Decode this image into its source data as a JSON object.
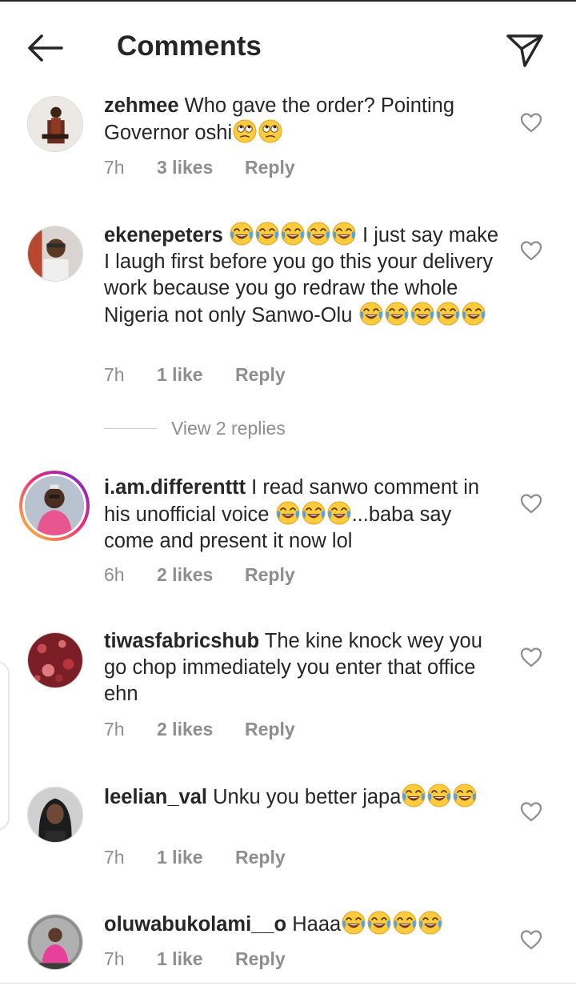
{
  "header": {
    "title": "Comments",
    "back_icon": "arrow-left-icon",
    "share_icon": "paper-plane-icon"
  },
  "view_replies_label": "View 2 replies",
  "comments": [
    {
      "username": "zehmee",
      "text_before": " Who gave the order? Pointing Governor oshi",
      "emojis_inline": [
        "face-with-rolling-eyes",
        "face-with-rolling-eyes"
      ],
      "time": "7h",
      "likes": "3 likes",
      "reply": "Reply"
    },
    {
      "username": "ekenepeters",
      "text_parts": [
        " ",
        " I just say make I laugh first before you go this your delivery work because you go redraw the whole Nigeria not only Sanwo-Olu "
      ],
      "emojis_inline": [
        "face-with-tears-of-joy"
      ],
      "time": "7h",
      "likes": "1 like",
      "reply": "Reply"
    },
    {
      "username": "i.am.differenttt",
      "text_parts": [
        " I read sanwo comment in his unofficial voice ",
        "...baba say  come and present it now lol"
      ],
      "time": "6h",
      "likes": "2 likes",
      "reply": "Reply"
    },
    {
      "username": "tiwasfabricshub",
      "text": " The kine knock wey you go chop immediately you enter that office ehn",
      "time": "7h",
      "likes": "2 likes",
      "reply": "Reply"
    },
    {
      "username": "leelian_val",
      "text": " Unku you better japa",
      "time": "7h",
      "likes": "1 like",
      "reply": "Reply"
    },
    {
      "username": "oluwabukolami__o",
      "text": " Haaa",
      "time": "7h",
      "likes": "1 like",
      "reply": "Reply"
    }
  ]
}
